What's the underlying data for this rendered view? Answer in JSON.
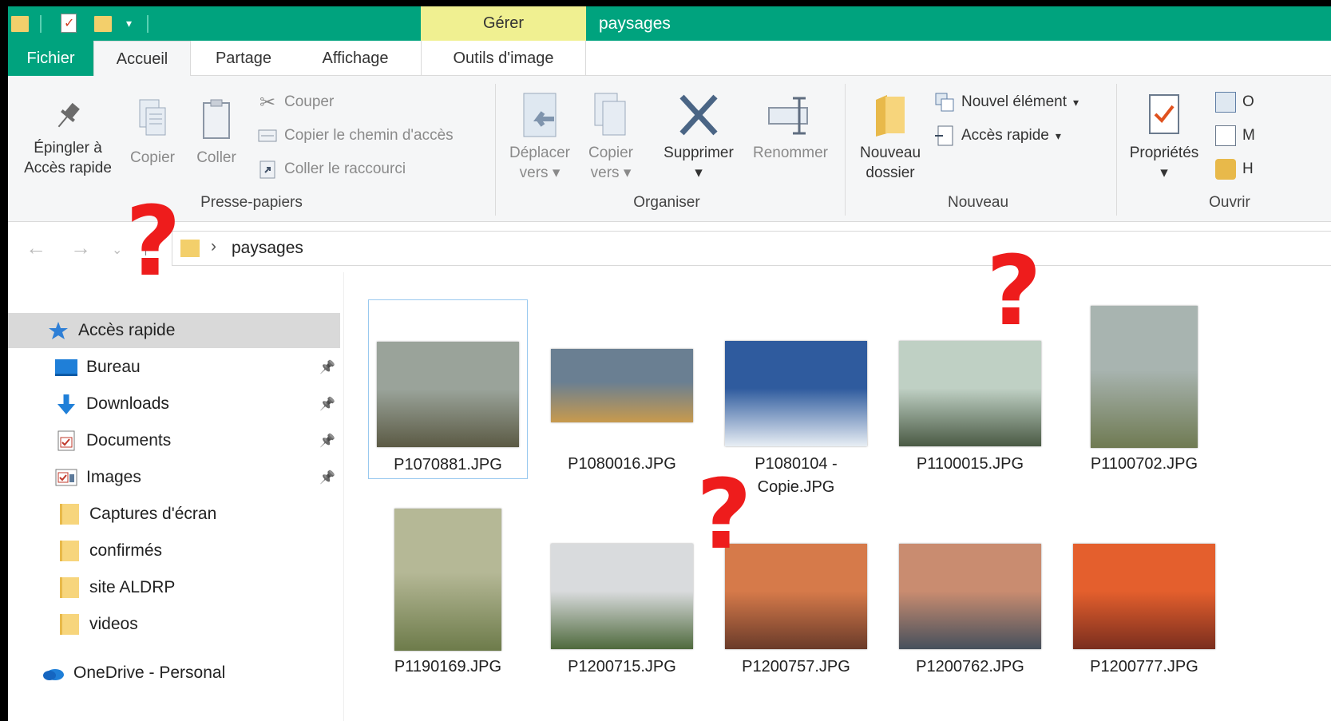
{
  "titlebar": {
    "context_tab": "Gérer",
    "window_title": "paysages"
  },
  "tabs": {
    "fichier": "Fichier",
    "accueil": "Accueil",
    "partage": "Partage",
    "affichage": "Affichage",
    "outils": "Outils d'image"
  },
  "ribbon": {
    "pin_line1": "Épingler à",
    "pin_line2": "Accès rapide",
    "copy": "Copier",
    "paste": "Coller",
    "cut": "Couper",
    "copy_path": "Copier le chemin d'accès",
    "paste_shortcut": "Coller le raccourci",
    "group_clipboard": "Presse-papiers",
    "move_line1": "Déplacer",
    "move_line2": "vers",
    "copyto_line1": "Copier",
    "copyto_line2": "vers",
    "delete": "Supprimer",
    "rename": "Renommer",
    "group_organize": "Organiser",
    "new_folder_line1": "Nouveau",
    "new_folder_line2": "dossier",
    "new_item": "Nouvel élément",
    "quick_access": "Accès rapide",
    "group_new": "Nouveau",
    "properties": "Propriétés",
    "group_open": "Ouvrir",
    "open_partial_1": "O",
    "open_partial_2": "M",
    "open_partial_3": "H",
    "dropdown_glyph": "▾"
  },
  "address": {
    "path": "paysages",
    "chevron": "›"
  },
  "nav": {
    "items": [
      {
        "label": "Accès rapide",
        "icon": "star-icon"
      },
      {
        "label": "Bureau",
        "icon": "desktop-icon",
        "pinned": true
      },
      {
        "label": "Downloads",
        "icon": "download-icon",
        "pinned": true
      },
      {
        "label": "Documents",
        "icon": "documents-icon",
        "pinned": true
      },
      {
        "label": "Images",
        "icon": "images-icon",
        "pinned": true
      },
      {
        "label": "Captures d'écran",
        "icon": "folder-icon"
      },
      {
        "label": "confirmés",
        "icon": "folder-icon"
      },
      {
        "label": "site ALDRP",
        "icon": "folder-icon"
      },
      {
        "label": "videos",
        "icon": "folder-icon"
      },
      {
        "label": "OneDrive - Personal",
        "icon": "onedrive-icon"
      }
    ]
  },
  "files": [
    {
      "name": "P1070881.JPG",
      "colors": [
        "#9aa39a",
        "#5b5a44"
      ]
    },
    {
      "name": "P1080016.JPG",
      "colors": [
        "#6a7f92",
        "#c89a4d"
      ]
    },
    {
      "name": "P1080104 - Copie.JPG",
      "line1": "P1080104 -",
      "line2": "Copie.JPG",
      "colors": [
        "#2f5b9e",
        "#e8eef4"
      ]
    },
    {
      "name": "P1100015.JPG",
      "colors": [
        "#bfd0c4",
        "#4a5a44"
      ]
    },
    {
      "name": "P1100702.JPG",
      "colors": [
        "#a8b4b0",
        "#6f7a52"
      ]
    },
    {
      "name": "P1190169.JPG",
      "colors": [
        "#b5b896",
        "#6d7b4a"
      ]
    },
    {
      "name": "P1200715.JPG",
      "colors": [
        "#d9dbdd",
        "#4f6a3d"
      ]
    },
    {
      "name": "P1200757.JPG",
      "colors": [
        "#d67a4a",
        "#6a3b2a"
      ]
    },
    {
      "name": "P1200762.JPG",
      "colors": [
        "#c98c70",
        "#46505c"
      ]
    },
    {
      "name": "P1200777.JPG",
      "colors": [
        "#e45f2d",
        "#7a2e1e"
      ]
    }
  ],
  "annotations": {
    "qmark": "?"
  }
}
